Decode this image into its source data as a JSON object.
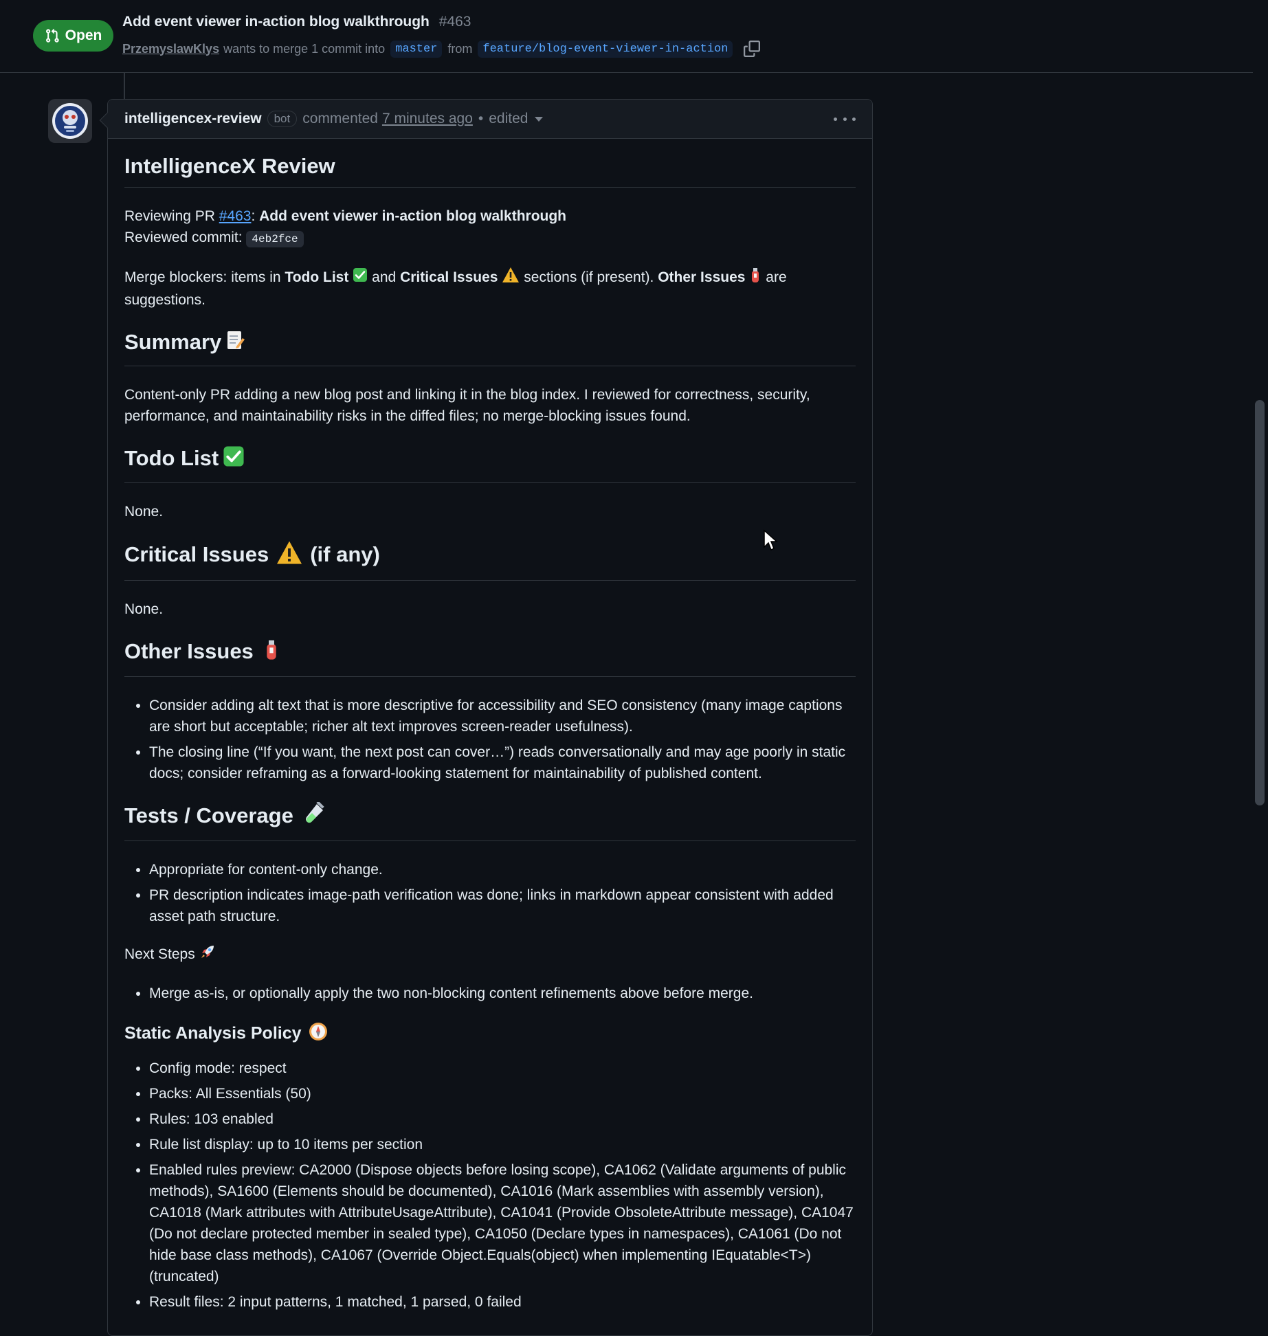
{
  "header": {
    "state": "Open",
    "title": "Add event viewer in-action blog walkthrough",
    "number": "#463",
    "author": "PrzemyslawKlys",
    "meta_merge": "wants to merge 1 commit into",
    "base_branch": "master",
    "meta_from": "from",
    "head_branch": "feature/blog-event-viewer-in-action"
  },
  "comment": {
    "author": "intelligencex-review",
    "bot_label": "bot",
    "action": "commented",
    "time": "7 minutes ago",
    "separator": "•",
    "edited": "edited"
  },
  "body": {
    "title": "IntelligenceX Review",
    "reviewing_prefix": "Reviewing PR ",
    "reviewing_link": "#463",
    "reviewing_colon": ": ",
    "reviewing_title": "Add event viewer in-action blog walkthrough",
    "commit_prefix": "Reviewed commit: ",
    "commit_hash": "4eb2fce",
    "blockers_1": "Merge blockers: items in ",
    "blockers_todo": "Todo List",
    "blockers_2": " and ",
    "blockers_critical": "Critical Issues",
    "blockers_3": " sections (if present). ",
    "blockers_other": "Other Issues",
    "blockers_4": " are suggestions.",
    "summary_heading": "Summary",
    "summary_text": "Content-only PR adding a new blog post and linking it in the blog index. I reviewed for correctness, security, performance, and maintainability risks in the diffed files; no merge-blocking issues found.",
    "todo_heading": "Todo List",
    "todo_text": "None.",
    "critical_heading": "Critical Issues",
    "critical_suffix": "(if any)",
    "critical_text": "None.",
    "other_heading": "Other Issues",
    "other_items": [
      "Consider adding alt text that is more descriptive for accessibility and SEO consistency (many image captions are short but acceptable; richer alt text improves screen-reader usefulness).",
      "The closing line (“If you want, the next post can cover…”) reads conversationally and may age poorly in static docs; consider reframing as a forward-looking statement for maintainability of published content."
    ],
    "tests_heading": "Tests / Coverage",
    "tests_items": [
      "Appropriate for content-only change.",
      "PR description indicates image-path verification was done; links in markdown appear consistent with added asset path structure."
    ],
    "next_steps_label": "Next Steps",
    "next_steps_items": [
      "Merge as-is, or optionally apply the two non-blocking content refinements above before merge."
    ],
    "policy_heading": "Static Analysis Policy",
    "policy_items": [
      "Config mode: respect",
      "Packs: All Essentials (50)",
      "Rules: 103 enabled",
      "Rule list display: up to 10 items per section",
      "Enabled rules preview: CA2000 (Dispose objects before losing scope), CA1062 (Validate arguments of public methods), SA1600 (Elements should be documented), CA1016 (Mark assemblies with assembly version), CA1018 (Mark attributes with AttributeUsageAttribute), CA1041 (Provide ObsoleteAttribute message), CA1047 (Do not declare protected member in sealed type), CA1050 (Declare types in namespaces), CA1061 (Do not hide base class methods), CA1067 (Override Object.Equals(object) when implementing IEquatable<T>) (truncated)",
      "Result files: 2 input patterns, 1 matched, 1 parsed, 0 failed"
    ]
  },
  "icons": {
    "state": "git-pull-request-icon",
    "copy": "copy-icon",
    "kebab": "kebab-horizontal-icon",
    "summary": "memo-emoji",
    "todo": "check-mark-button-emoji",
    "critical": "warning-emoji",
    "other": "fire-extinguisher-emoji",
    "tests": "test-tube-emoji",
    "next": "rocket-emoji",
    "policy": "compass-emoji"
  },
  "colors": {
    "open_badge": "#238636",
    "link": "#58a6ff",
    "background": "#0d1117",
    "border": "#30363d"
  }
}
